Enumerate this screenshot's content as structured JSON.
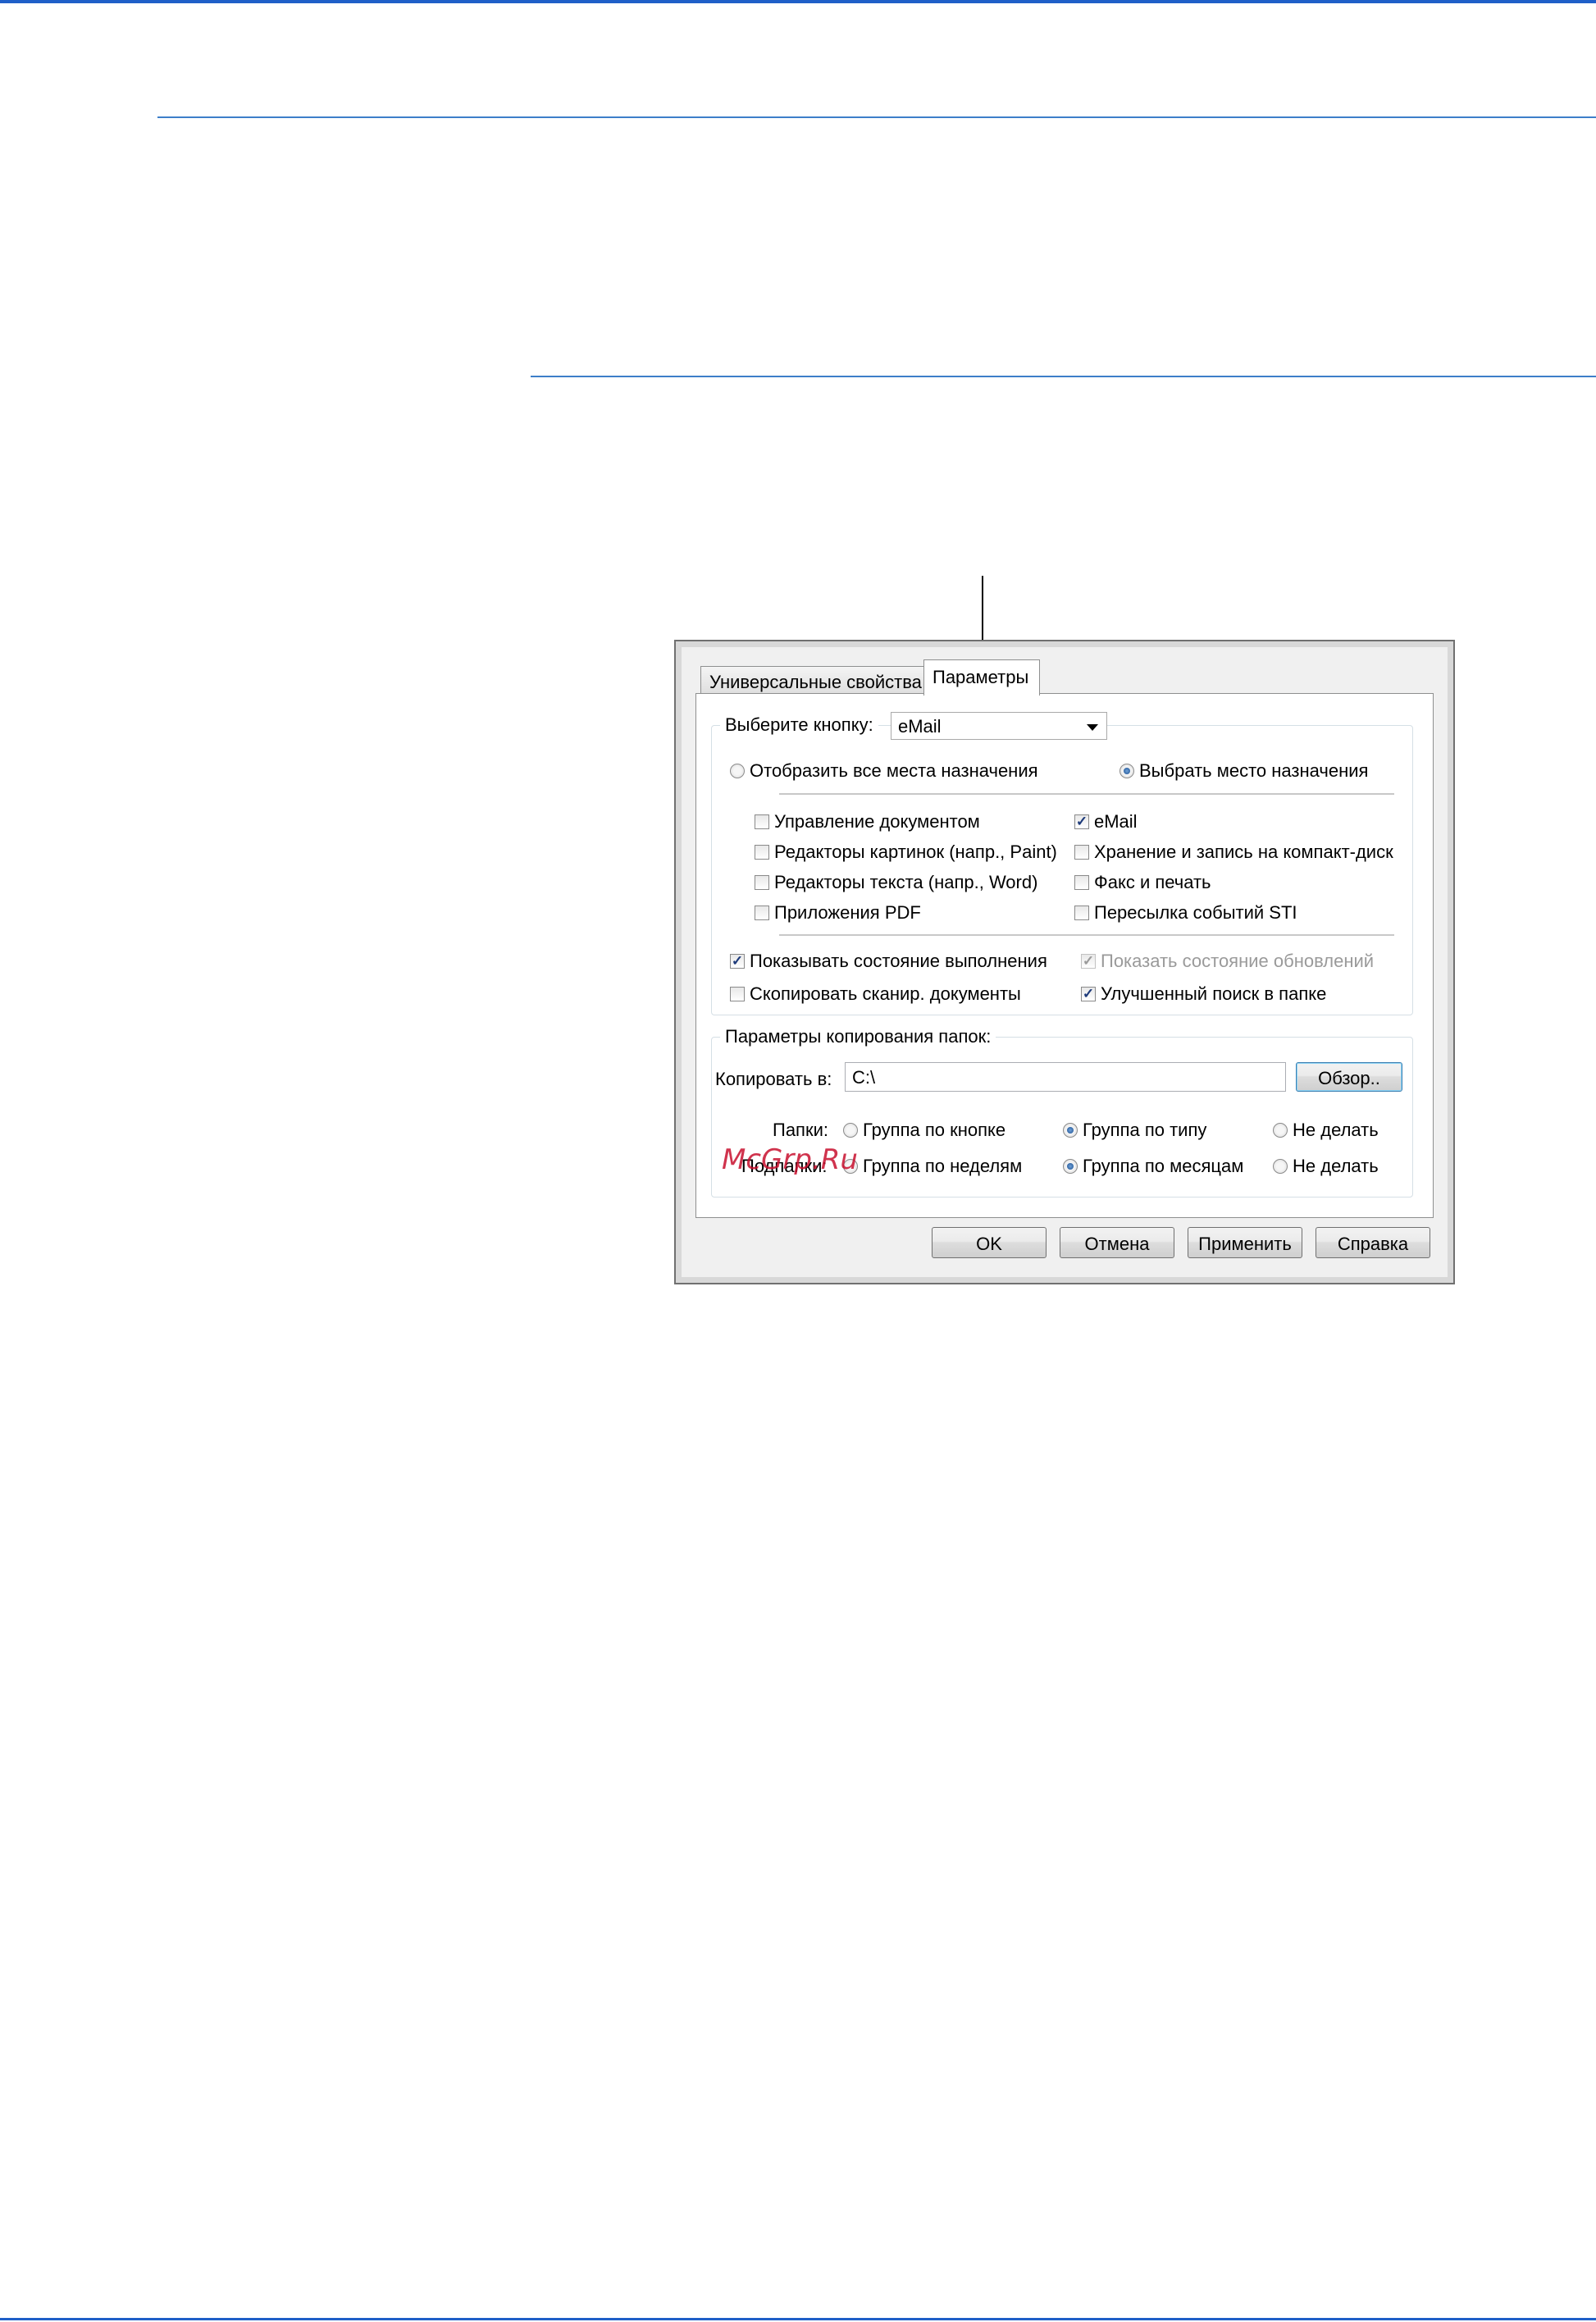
{
  "dialog": {
    "tabs": [
      "Универсальные свойства",
      "Параметры"
    ],
    "select_button": {
      "label": "Выберите кнопку:",
      "value": "eMail"
    },
    "destination_mode": {
      "show_all": "Отобразить все места назначения",
      "choose": "Выбрать место назначения",
      "selected": "choose"
    },
    "destinations": [
      {
        "label": "Управление документом",
        "checked": false
      },
      {
        "label": "eMail",
        "checked": true
      },
      {
        "label": "Редакторы картинок (напр., Paint)",
        "checked": false
      },
      {
        "label": "Хранение и запись на компакт-диск",
        "checked": false
      },
      {
        "label": "Редакторы текста (напр., Word)",
        "checked": false
      },
      {
        "label": "Факс и печать",
        "checked": false
      },
      {
        "label": "Приложения PDF",
        "checked": false
      },
      {
        "label": "Пересылка событий STI",
        "checked": false
      }
    ],
    "options": [
      {
        "label": "Показывать состояние выполнения",
        "checked": true,
        "enabled": true
      },
      {
        "label": "Показать состояние обновлений",
        "checked": true,
        "enabled": false
      },
      {
        "label": "Скопировать сканир. документы",
        "checked": false,
        "enabled": true
      },
      {
        "label": "Улучшенный поиск в папке",
        "checked": true,
        "enabled": true
      }
    ],
    "copy_group": {
      "legend": "Параметры копирования папок:",
      "copy_to_label": "Копировать в:",
      "copy_to_value": "C:\\",
      "browse": "Обзор..",
      "folders_label": "Папки:",
      "folders_options": [
        "Группа по кнопке",
        "Группа по типу",
        "Не делать"
      ],
      "folders_selected": 1,
      "subfolders_label": "Подпапки:",
      "subfolders_options": [
        "Группа по неделям",
        "Группа по месяцам",
        "Не делать"
      ],
      "subfolders_selected": 1
    },
    "buttons": {
      "ok": "OK",
      "cancel": "Отмена",
      "apply": "Применить",
      "help": "Справка"
    }
  },
  "watermark": "McGrp.Ru",
  "colors": {
    "accent_rule": "#3d7ec9",
    "watermark": "#c8102e"
  }
}
